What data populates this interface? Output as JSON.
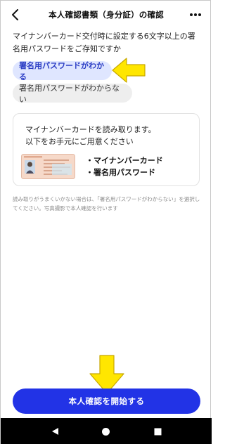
{
  "header": {
    "title": "本人確認書類（身分証）の確認",
    "back_icon": "chevron-left-icon",
    "more_icon": "more-horizontal-icon"
  },
  "question": "マイナンバーカード交付時に設定する6文字以上の署名用パスワードをご存知ですか",
  "options": [
    {
      "label": "署名用パスワードがわかる",
      "selected": true
    },
    {
      "label": "署名用パスワードがわからない",
      "selected": false
    }
  ],
  "card": {
    "line1": "マイナンバーカードを読み取ります。",
    "line2": "以下をお手元にご用意ください",
    "items": [
      "・マイナンバーカード",
      "・署名用パスワード"
    ]
  },
  "note": "読み取りがうまくいかない場合は、「署名用パスワードがわからない」を選択してください。写真撮影で本人確認を行います",
  "start_button": "本人確認を開始する",
  "colors": {
    "accent": "#2233e6",
    "selected_bg": "#dfe6ff",
    "annotation_arrow": "#ffe600"
  },
  "navbar": {
    "back_icon": "triangle-back-icon",
    "home_icon": "circle-home-icon",
    "recents_icon": "square-recents-icon"
  }
}
